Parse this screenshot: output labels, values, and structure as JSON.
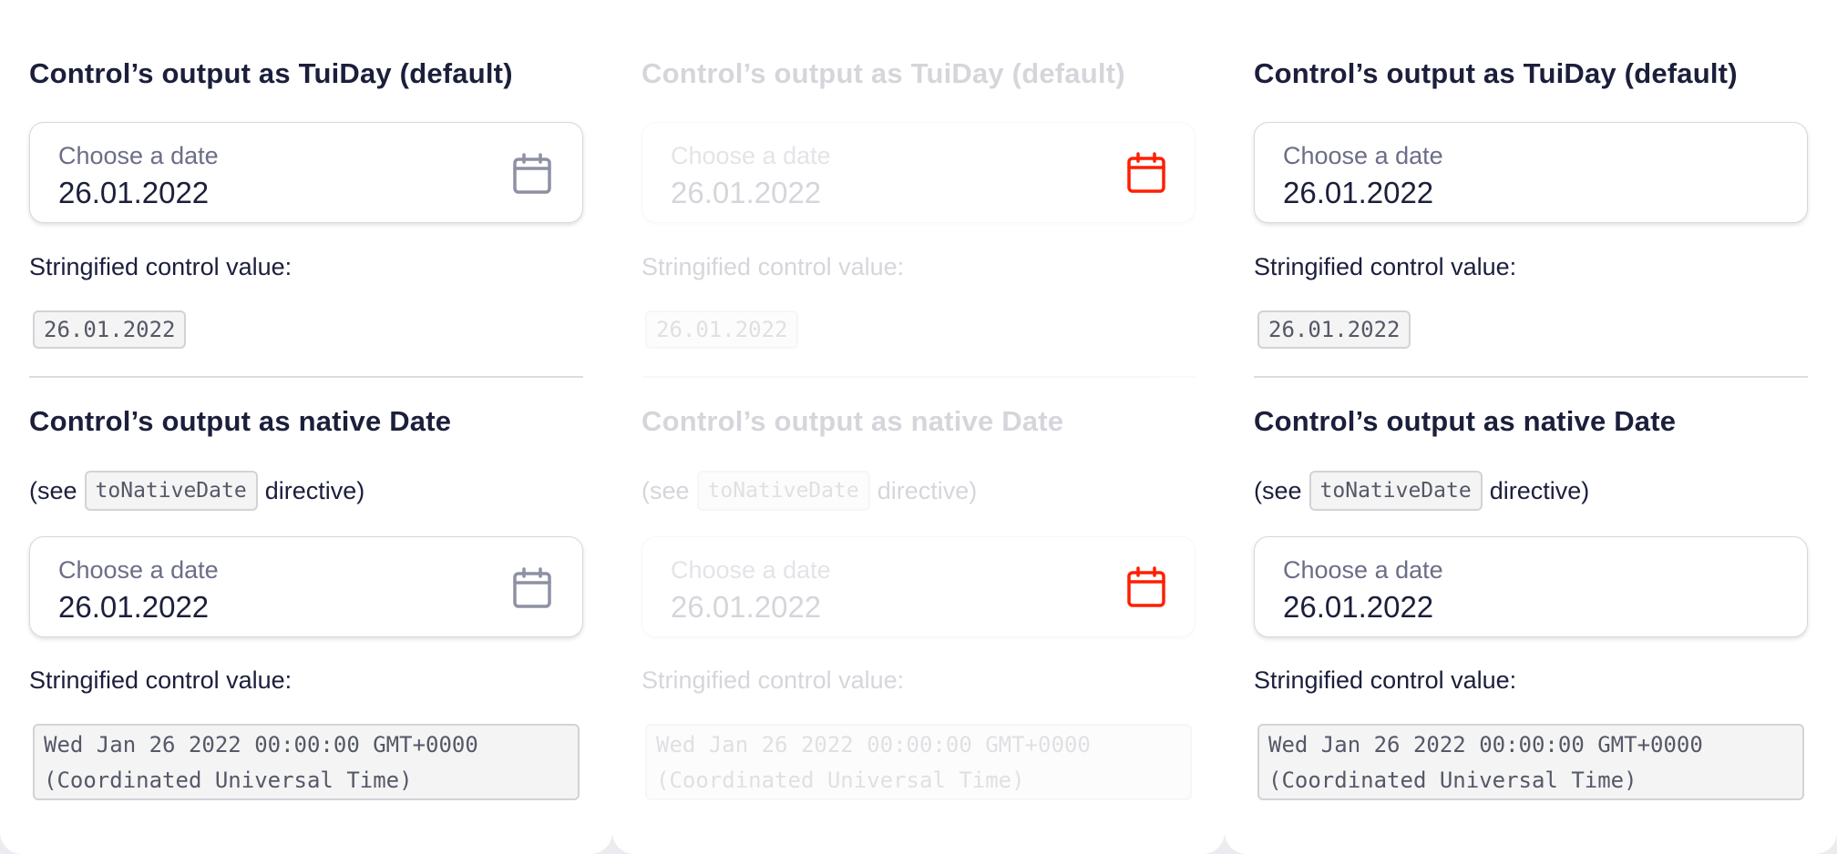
{
  "panels": [
    {
      "title_tuiday": "Control’s output as TuiDay (default)",
      "title_native": "Control’s output as native Date",
      "see_prefix": "(see",
      "see_code": "toNativeDate",
      "see_suffix": "directive)",
      "field1": {
        "label": "Choose a date",
        "value": "26.01.2022",
        "icon": "calendar-icon"
      },
      "field2": {
        "label": "Choose a date",
        "value": "26.01.2022",
        "icon": "calendar-icon"
      },
      "stringified_label": "Stringified control value:",
      "value1": "26.01.2022",
      "value2": "Wed Jan 26 2022 00:00:00 GMT+0000\n(Coordinated Universal Time)",
      "icon_color": "#8e90a3"
    },
    {
      "title_tuiday": "Control’s output as TuiDay (default)",
      "title_native": "Control’s output as native Date",
      "see_prefix": "(see",
      "see_code": "toNativeDate",
      "see_suffix": "directive)",
      "field1": {
        "label": "Choose a date",
        "value": "26.01.2022",
        "icon": "calendar-icon"
      },
      "field2": {
        "label": "Choose a date",
        "value": "26.01.2022",
        "icon": "calendar-icon"
      },
      "stringified_label": "Stringified control value:",
      "value1": "26.01.2022",
      "value2": "Wed Jan 26 2022 00:00:00 GMT+0000\n(Coordinated Universal Time)",
      "icon_color": "#ff1f00",
      "state": "disabled"
    },
    {
      "title_tuiday": "Control’s output as TuiDay (default)",
      "title_native": "Control’s output as native Date",
      "see_prefix": "(see",
      "see_code": "toNativeDate",
      "see_suffix": "directive)",
      "field1": {
        "label": "Choose a date",
        "value": "26.01.2022"
      },
      "field2": {
        "label": "Choose a date",
        "value": "26.01.2022"
      },
      "stringified_label": "Stringified control value:",
      "value1": "26.01.2022",
      "value2": "Wed Jan 26 2022 00:00:00 GMT+0000\n(Coordinated Universal Time)"
    }
  ]
}
